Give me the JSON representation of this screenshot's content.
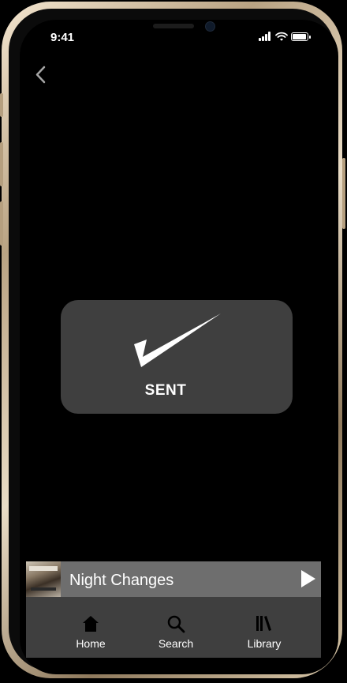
{
  "status_bar": {
    "time": "9:41"
  },
  "toast": {
    "label": "SENT"
  },
  "now_playing": {
    "title": "Night Changes"
  },
  "tabs": [
    {
      "label": "Home",
      "icon": "home-icon"
    },
    {
      "label": "Search",
      "icon": "search-icon"
    },
    {
      "label": "Library",
      "icon": "library-icon"
    }
  ],
  "colors": {
    "toast_bg": "#3f3f3f",
    "tab_bar_bg": "#3f3f3f",
    "now_playing_bg": "#6e6e6e",
    "screen_bg": "#000000",
    "frame_gold": "#d9c8aa"
  }
}
